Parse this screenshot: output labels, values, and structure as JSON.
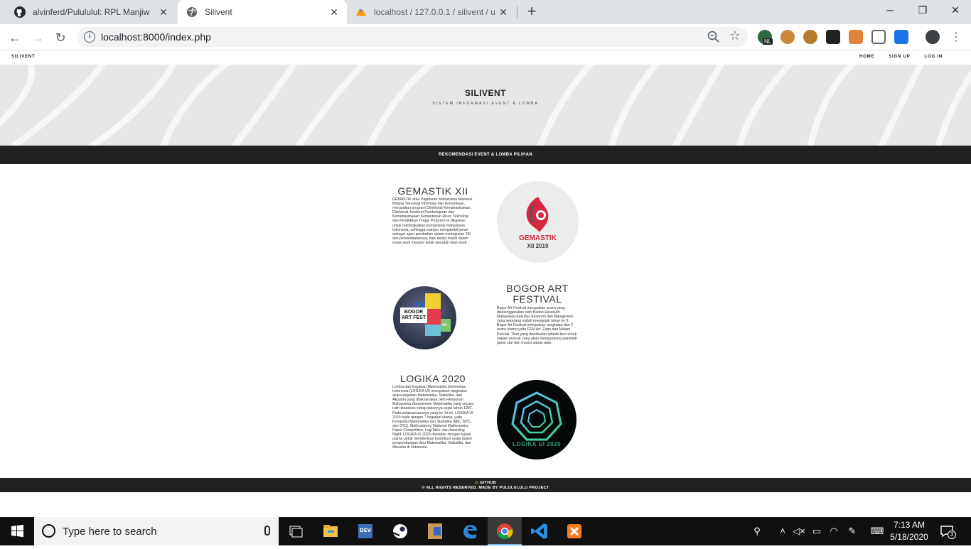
{
  "browser": {
    "tabs": [
      {
        "title": "alvinferd/Pulululul: RPL Manjiw",
        "favicon": "github-icon"
      },
      {
        "title": "Silivent",
        "favicon": "globe-icon"
      },
      {
        "title": "localhost / 127.0.0.1 / silivent / u",
        "favicon": "phpmyadmin-icon"
      }
    ],
    "url": "localhost:8000/index.php",
    "zoom_badge": "NL"
  },
  "site": {
    "brand": "SILIVENT",
    "nav": [
      "HOME",
      "SIGN UP",
      "LOG IN"
    ],
    "hero_title": "SILIVENT",
    "hero_subtitle": "SISTEM INFORMASI EVENT & LOMBA",
    "band": "REKOMENDASI EVENT & LOMBA PILIHAN",
    "events": [
      {
        "title": "GEMASTIK XII",
        "desc": "GEMASTIK atau Pagelaran Mahasiswa Nasional Bidang Teknologi Informasi dan Komunikasi, merupakan program Direktorat Kemahasiswaan, Direktorat Jenderal Pembelajaran dan Kemahasiswaan Kementerian Riset, Teknologi dan Pendidikan Tinggi. Program ini ditujukan untuk meningkatkan kompetensi mahasiswa Indonesia, sehingga mampu mengambil peran sebagai agen perubahan dalam memajukan TIK dan pemanfaatannya, baik ketika masih dalam masa studi maupun kelak sesudah lulus studi.",
        "logo_line1": "GEMASTIK",
        "logo_line2": "XII 2019"
      },
      {
        "title": "BOGOR ART FESTIVAL",
        "desc": "Bogor Art Festival merupakan acara yang diselenggarakan oleh Badan Eksekutif Mahasiswa Fakultas Ekonomi dan Manajemen yang sekarang sudah menginjak tahun ke 9. Bogor Art Festival merupakan rangkaian dari 2 acara utama yaitu FEM Art, Expo dan Malam Puncak. Tiket yang disediakan adalah tiket untuk malam puncak yang akan mengundang sejumlah guest star dan musisi papan atas.",
        "logo_line1": "BOGOR",
        "logo_line2": "ART FEST",
        "logo_badge": "9th"
      },
      {
        "title": "LOGIKA 2020",
        "desc": "Lomba dan Kegiatan Matematika Universitas Indonesia (LOGIKA UI) merupakan rangkaian acara kegiatan Matematika, Statistika, dan Aktuaria yang dilaksanakan oleh Himpunan Mahasiswa Departemen Matematika yang secara rutin diadakan setiap tahunnya sejak tahun 1997. Pada pelaksanaannya yang ke-1d ini, LOGIKA UI 2020 hadir dengan 7 kegiatan utama, yaitu Kompetisi Matematika dan Statistika (MIC, MTC, dan STC), Mathcademy, National Mathematics Paper Competition, LogiTalks, dan Awarding Night. LOGIKA UI 2020 diadakan dengan tujuan utama untuk memberikan kontribusi nyata dalam pengembangan ilmu Matematika, Statistika, dan Aktuaria di Indonesia.",
        "logo_text": "LOGIKA UI 2020"
      }
    ],
    "footer_github": "GITHUB",
    "footer_copy": "© ALL RIGHTS RESERVED. MADE BY PULULULULU PROJECT"
  },
  "taskbar": {
    "search_placeholder": "Type here to search",
    "time": "7:13 AM",
    "date": "5/18/2020",
    "notification_count": "3",
    "apps": [
      "task-view-icon",
      "file-explorer-icon",
      "devc-icon",
      "steam-icon",
      "photo-app-icon",
      "edge-icon",
      "chrome-icon",
      "vscode-icon",
      "xampp-icon"
    ]
  },
  "colors": {
    "tabstrip": "#dee1e6",
    "dark_band": "#212121",
    "hero_bg": "#e9e9e9",
    "gemastik_red": "#d7263d",
    "taskbar": "#101010"
  }
}
